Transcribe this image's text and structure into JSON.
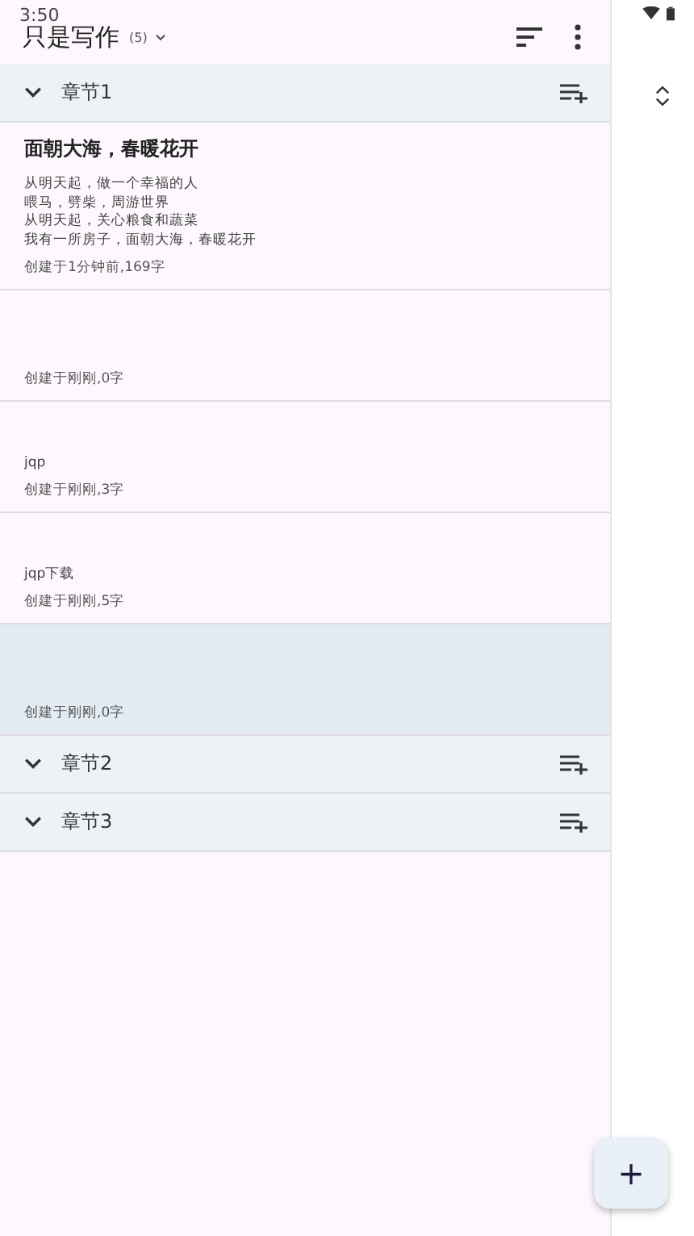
{
  "status_bar": {
    "time": "3:50"
  },
  "app_bar": {
    "title": "只是写作",
    "count": "(5)"
  },
  "chapters": [
    {
      "title": "章节1",
      "notes": [
        {
          "title": "面朝大海，春暖花开",
          "lines": [
            "从明天起，做一个幸福的人",
            "喂马，劈柴，周游世界",
            "从明天起，关心粮食和蔬菜",
            "我有一所房子，面朝大海，春暖花开"
          ],
          "meta": "创建于1分钟前,169字",
          "selected": false
        },
        {
          "meta": "创建于刚刚,0字",
          "selected": false
        },
        {
          "lines": [
            "jqp"
          ],
          "meta": "创建于刚刚,3字",
          "selected": false
        },
        {
          "lines": [
            "jqp下载"
          ],
          "meta": "创建于刚刚,5字",
          "selected": false
        },
        {
          "meta": "创建于刚刚,0字",
          "selected": true
        }
      ]
    },
    {
      "title": "章节2"
    },
    {
      "title": "章节3"
    }
  ],
  "fab": {
    "label": "+"
  }
}
